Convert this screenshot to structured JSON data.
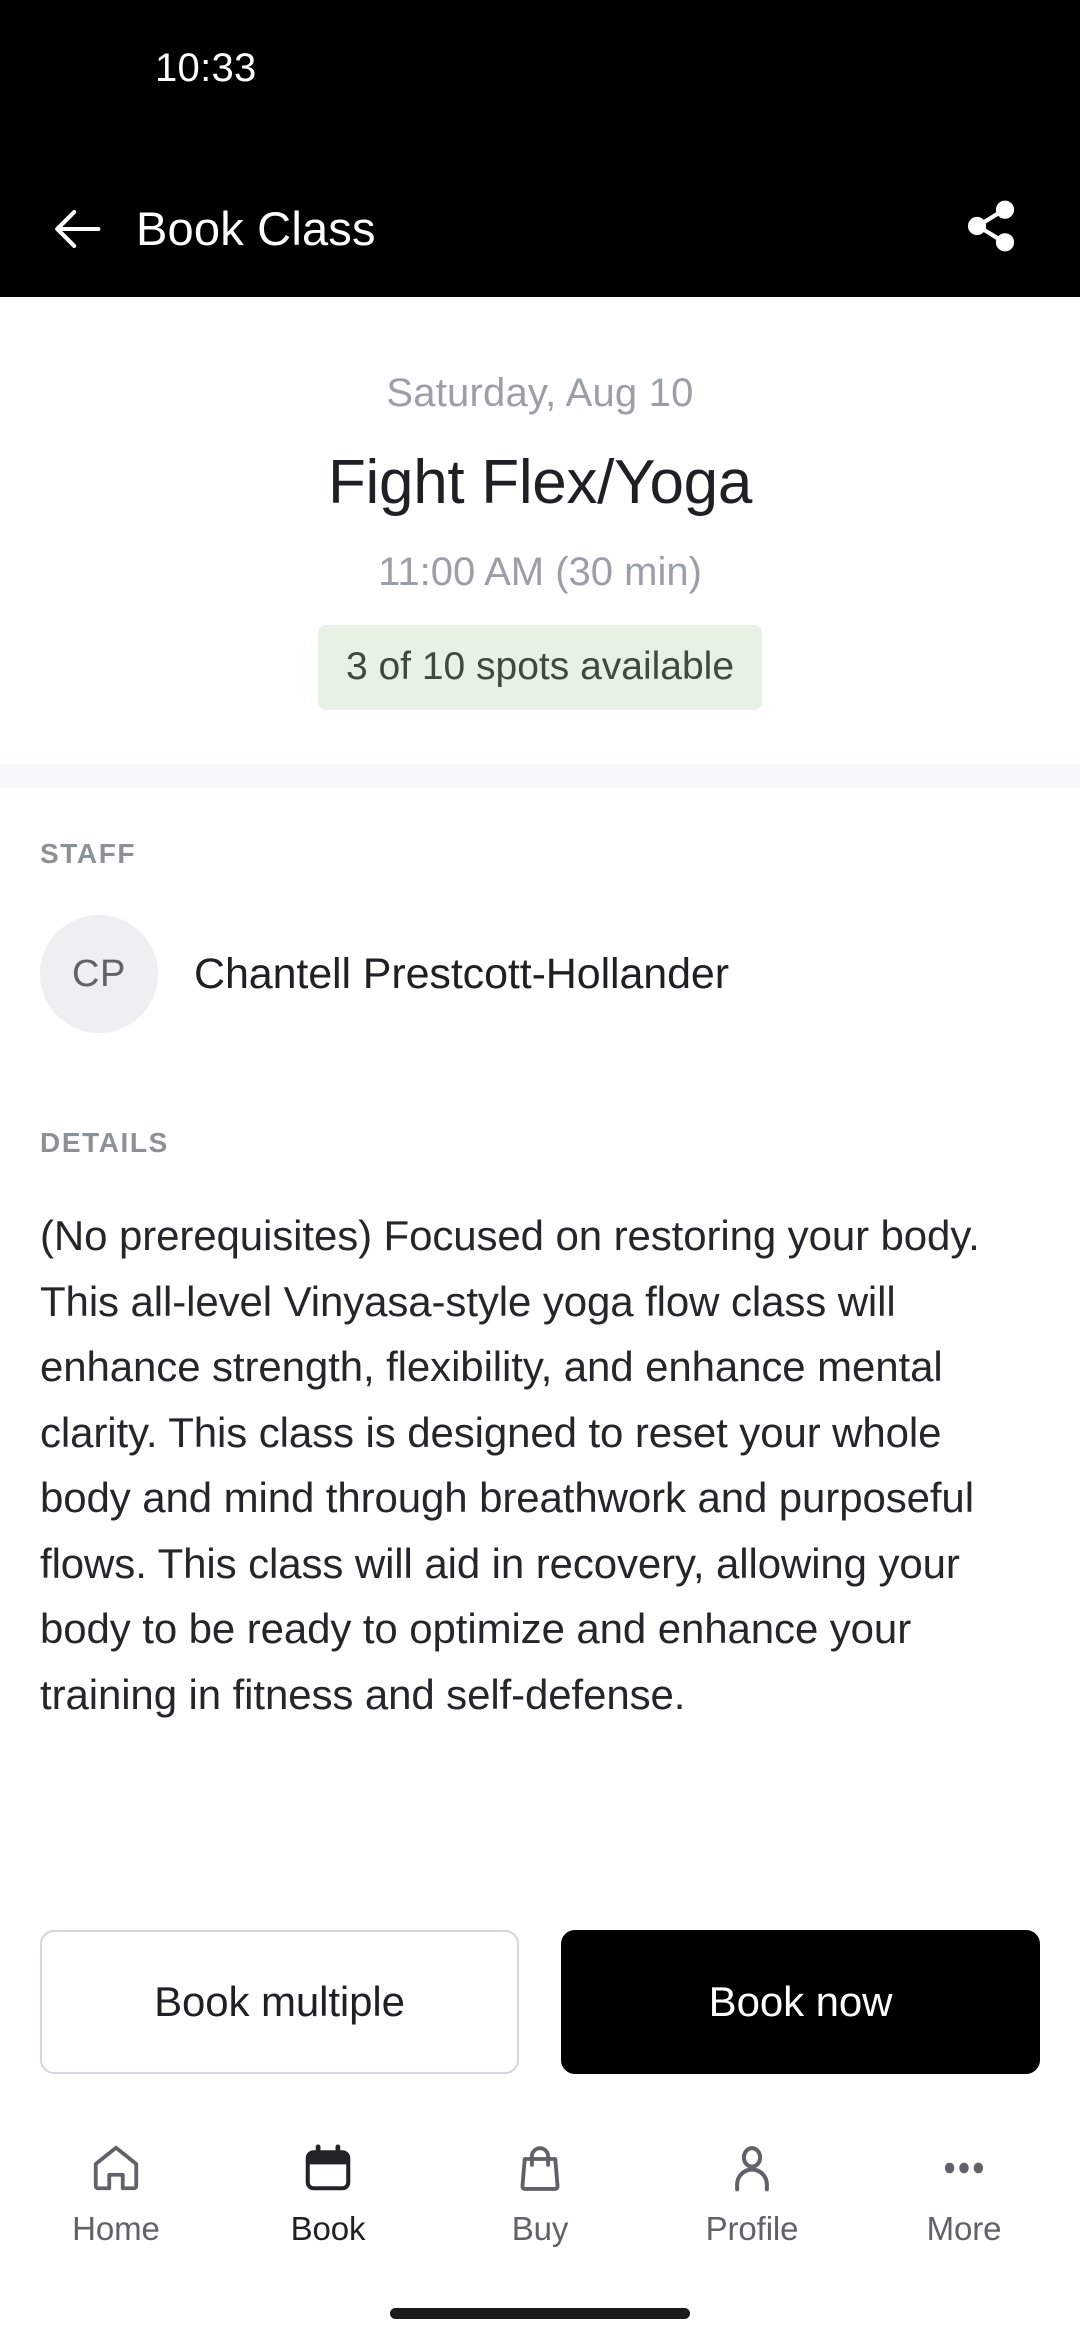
{
  "status_bar": {
    "time": "10:33"
  },
  "app_bar": {
    "title": "Book Class",
    "back_icon": "arrow-left-icon",
    "share_icon": "share-icon"
  },
  "class_header": {
    "date": "Saturday, Aug 10",
    "title": "Fight Flex/Yoga",
    "time": "11:00 AM (30 min)",
    "availability": "3 of 10 spots available",
    "availability_bg": "#e7f1e4",
    "availability_text_color": "#3d4a3c"
  },
  "staff_section": {
    "label": "STAFF",
    "avatar_initials": "CP",
    "name": "Chantell Prestcott-Hollander"
  },
  "details_section": {
    "label": "DETAILS",
    "body": "(No prerequisites) Focused on restoring your body. This all-level Vinyasa-style yoga flow class will enhance strength, flexibility, and enhance mental clarity. This class is designed to reset your whole body and mind through breathwork and purposeful flows. This class will aid in recovery, allowing your body to be ready to optimize and enhance your training in fitness and self-defense."
  },
  "actions": {
    "secondary_label": "Book multiple",
    "primary_label": "Book now",
    "primary_bg": "#000000",
    "primary_text_color": "#ffffff"
  },
  "bottom_nav": {
    "items": [
      {
        "label": "Home",
        "icon": "home-icon",
        "active": false
      },
      {
        "label": "Book",
        "icon": "calendar-icon",
        "active": true
      },
      {
        "label": "Buy",
        "icon": "bag-icon",
        "active": false
      },
      {
        "label": "Profile",
        "icon": "person-icon",
        "active": false
      },
      {
        "label": "More",
        "icon": "more-dots-icon",
        "active": false
      }
    ]
  }
}
